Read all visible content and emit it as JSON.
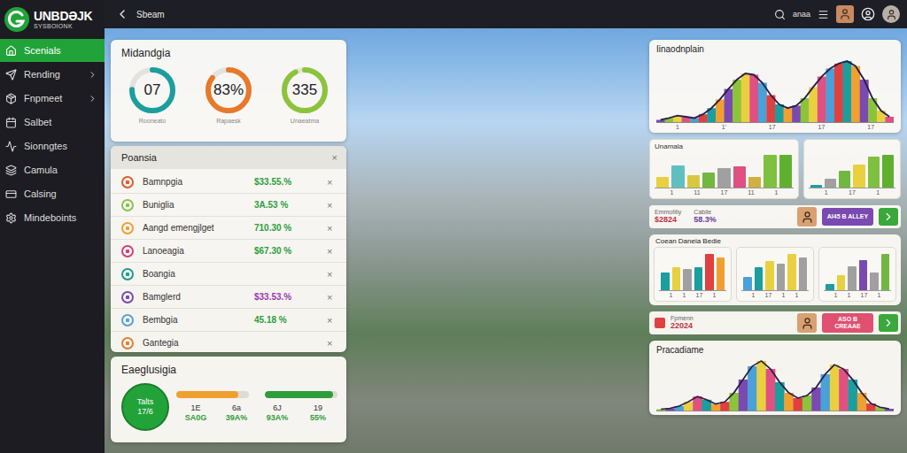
{
  "logo": {
    "title": "UNBDƏJK",
    "subtitle": "SYSBOIONK"
  },
  "sidebar": {
    "items": [
      {
        "label": "Scenials",
        "selected": true,
        "has_submenu": false
      },
      {
        "label": "Rending",
        "selected": false,
        "has_submenu": true
      },
      {
        "label": "Fnpmeet",
        "selected": false,
        "has_submenu": true
      },
      {
        "label": "Salbet",
        "selected": false,
        "has_submenu": false
      },
      {
        "label": "Sionngtes",
        "selected": false,
        "has_submenu": false
      },
      {
        "label": "Camula",
        "selected": false,
        "has_submenu": false
      },
      {
        "label": "Calsing",
        "selected": false,
        "has_submenu": false
      },
      {
        "label": "Mindeboints",
        "selected": false,
        "has_submenu": false
      }
    ]
  },
  "top_bar": {
    "title": "Sbeam",
    "label": "anaa"
  },
  "gauges_card": {
    "title": "Midandgia",
    "gauges": [
      {
        "value": "07",
        "caption": "Rooneato",
        "level": 0.75,
        "color": "#1a9e9e"
      },
      {
        "value": "83%",
        "caption": "Rapaesk",
        "level": 0.85,
        "color": "#e8782a"
      },
      {
        "value": "335",
        "caption": "Unaeatma",
        "level": 0.92,
        "color": "#8bc43a"
      }
    ]
  },
  "list_card": {
    "title": "Poansia",
    "close": "×",
    "rows": [
      {
        "name": "Bamnpgia",
        "value": "$33.55.%",
        "color": "#e05a2b",
        "value_color": "#2e9e3a",
        "remove": "×"
      },
      {
        "name": "Buniglia",
        "value": "3A.53 %",
        "color": "#8bc34a",
        "value_color": "#2e9e3a",
        "remove": "×"
      },
      {
        "name": "Aangd emengjlget",
        "value": "710.30 %",
        "color": "#f0a030",
        "value_color": "#2e9e3a",
        "remove": "×"
      },
      {
        "name": "Lanoeagia",
        "value": "$67.30 %",
        "color": "#d4407a",
        "value_color": "#2e9e3a",
        "remove": "×"
      },
      {
        "name": "Boangia",
        "value": "",
        "color": "#1a9e8e",
        "value_color": "#2e9e3a",
        "remove": "×"
      },
      {
        "name": "Bamglerd",
        "value": "$33.53.%",
        "color": "#7a4ab0",
        "value_color": "#9a3ab0",
        "remove": "×"
      },
      {
        "name": "Bembgia",
        "value": "45.18 %",
        "color": "#5aa0d0",
        "value_color": "#2e9e3a",
        "remove": "×"
      },
      {
        "name": "Gantegia",
        "value": "",
        "color": "#e08030",
        "value_color": "#2e9e3a",
        "remove": "×"
      }
    ]
  },
  "totals_card": {
    "title": "Eaeglusigia",
    "badge": {
      "label": "Talts",
      "value": "17/6"
    },
    "bars": [
      {
        "level": 0.85,
        "color": "#f0a030"
      },
      {
        "level": 0.94,
        "color": "#2e9e3a"
      }
    ],
    "stats": [
      {
        "top": "1E",
        "bottom": "SA0G"
      },
      {
        "top": "6a",
        "bottom": "39A%"
      },
      {
        "top": "6J",
        "bottom": "93A%"
      },
      {
        "top": "19",
        "bottom": "55%"
      }
    ]
  },
  "wave_top": {
    "title": "Iinaodnplain",
    "ticks": [
      "1",
      "1'",
      "17",
      "17",
      "17"
    ],
    "values": [
      5,
      8,
      12,
      10,
      8,
      14,
      24,
      38,
      55,
      70,
      80,
      78,
      65,
      45,
      30,
      24,
      28,
      40,
      58,
      75,
      88,
      96,
      100,
      92,
      70,
      40,
      20,
      10
    ],
    "stripe_colors": [
      "#7a4ab0",
      "#8bc43a",
      "#e8d040",
      "#e05080",
      "#4aa0d8",
      "#e04040",
      "#1a9e9e",
      "#f0a030"
    ]
  },
  "bar_row": [
    {
      "title": "Unamala",
      "ticks": [
        "1",
        "11",
        "17",
        "11",
        "1"
      ],
      "bars": [
        {
          "value": 20,
          "color": "#e8d040"
        },
        {
          "value": 40,
          "color": "#60c0c0"
        },
        {
          "value": 22,
          "color": "#d8c840"
        },
        {
          "value": 28,
          "color": "#70b840"
        },
        {
          "value": 35,
          "color": "#a0a0a0"
        },
        {
          "value": 38,
          "color": "#e05080"
        },
        {
          "value": 20,
          "color": "#d0b040"
        },
        {
          "value": 60,
          "color": "#80c040"
        },
        {
          "value": 60,
          "color": "#60b030"
        }
      ]
    },
    {
      "title": "",
      "ticks": [
        "1",
        "17",
        "1"
      ],
      "bars": [
        {
          "value": 5,
          "color": "#1a9e9e"
        },
        {
          "value": 15,
          "color": "#a0a0a0"
        },
        {
          "value": 30,
          "color": "#70b840"
        },
        {
          "value": 40,
          "color": "#e8d040"
        },
        {
          "value": 55,
          "color": "#80c040"
        },
        {
          "value": 58,
          "color": "#60b030"
        }
      ]
    }
  ],
  "strips": [
    {
      "kind": "stats",
      "stats": [
        {
          "label": "Emmotiliy",
          "value": "$2824",
          "color": "#c03040"
        },
        {
          "label": "Cabile",
          "value": "58.3%",
          "color": "#6a3a9a"
        }
      ],
      "button": {
        "label": "AI45 B ALLEY",
        "color": "#7a4ab0"
      }
    },
    {
      "kind": "alert",
      "stats": [
        {
          "label": "Fpmenn",
          "value": "22024",
          "color": "#c03040"
        }
      ],
      "button": {
        "label": "ASO B CREAAE",
        "color": "#e05070"
      }
    }
  ],
  "bar_group": {
    "title": "Coean Daneia Bedie",
    "charts": [
      {
        "ticks": [
          "1",
          "1",
          "17",
          "1"
        ],
        "bars": [
          {
            "value": 30,
            "color": "#1a9e9e"
          },
          {
            "value": 38,
            "color": "#e8d040"
          },
          {
            "value": 35,
            "color": "#a0a0a0"
          },
          {
            "value": 38,
            "color": "#1a9e9e"
          },
          {
            "value": 60,
            "color": "#e04040"
          },
          {
            "value": 55,
            "color": "#f0a030"
          }
        ]
      },
      {
        "ticks": [
          "1",
          "17",
          "1",
          "1"
        ],
        "bars": [
          {
            "value": 20,
            "color": "#4aa0d8"
          },
          {
            "value": 35,
            "color": "#1a9e9e"
          },
          {
            "value": 45,
            "color": "#e8d040"
          },
          {
            "value": 40,
            "color": "#a0a0a0"
          },
          {
            "value": 55,
            "color": "#e8d040"
          },
          {
            "value": 50,
            "color": "#a0a0a0"
          }
        ]
      },
      {
        "ticks": [
          "1",
          "1",
          "17",
          "1"
        ],
        "bars": [
          {
            "value": 10,
            "color": "#1a9e9e"
          },
          {
            "value": 25,
            "color": "#e8d040"
          },
          {
            "value": 40,
            "color": "#a0a0a0"
          },
          {
            "value": 50,
            "color": "#7a4ab0"
          },
          {
            "value": 30,
            "color": "#a0a0a0"
          },
          {
            "value": 60,
            "color": "#70b840"
          }
        ]
      }
    ]
  },
  "wave_bottom": {
    "title": "Pracadiame",
    "ticks": [],
    "values": [
      4,
      6,
      10,
      18,
      28,
      22,
      14,
      18,
      35,
      60,
      85,
      95,
      80,
      55,
      35,
      25,
      30,
      45,
      70,
      88,
      80,
      60,
      35,
      15,
      8,
      5
    ],
    "stripe_colors": [
      "#8bc43a",
      "#7a4ab0",
      "#4aa0d8",
      "#e8d040",
      "#e05080",
      "#1a9e9e",
      "#f0a030",
      "#e04040"
    ]
  }
}
